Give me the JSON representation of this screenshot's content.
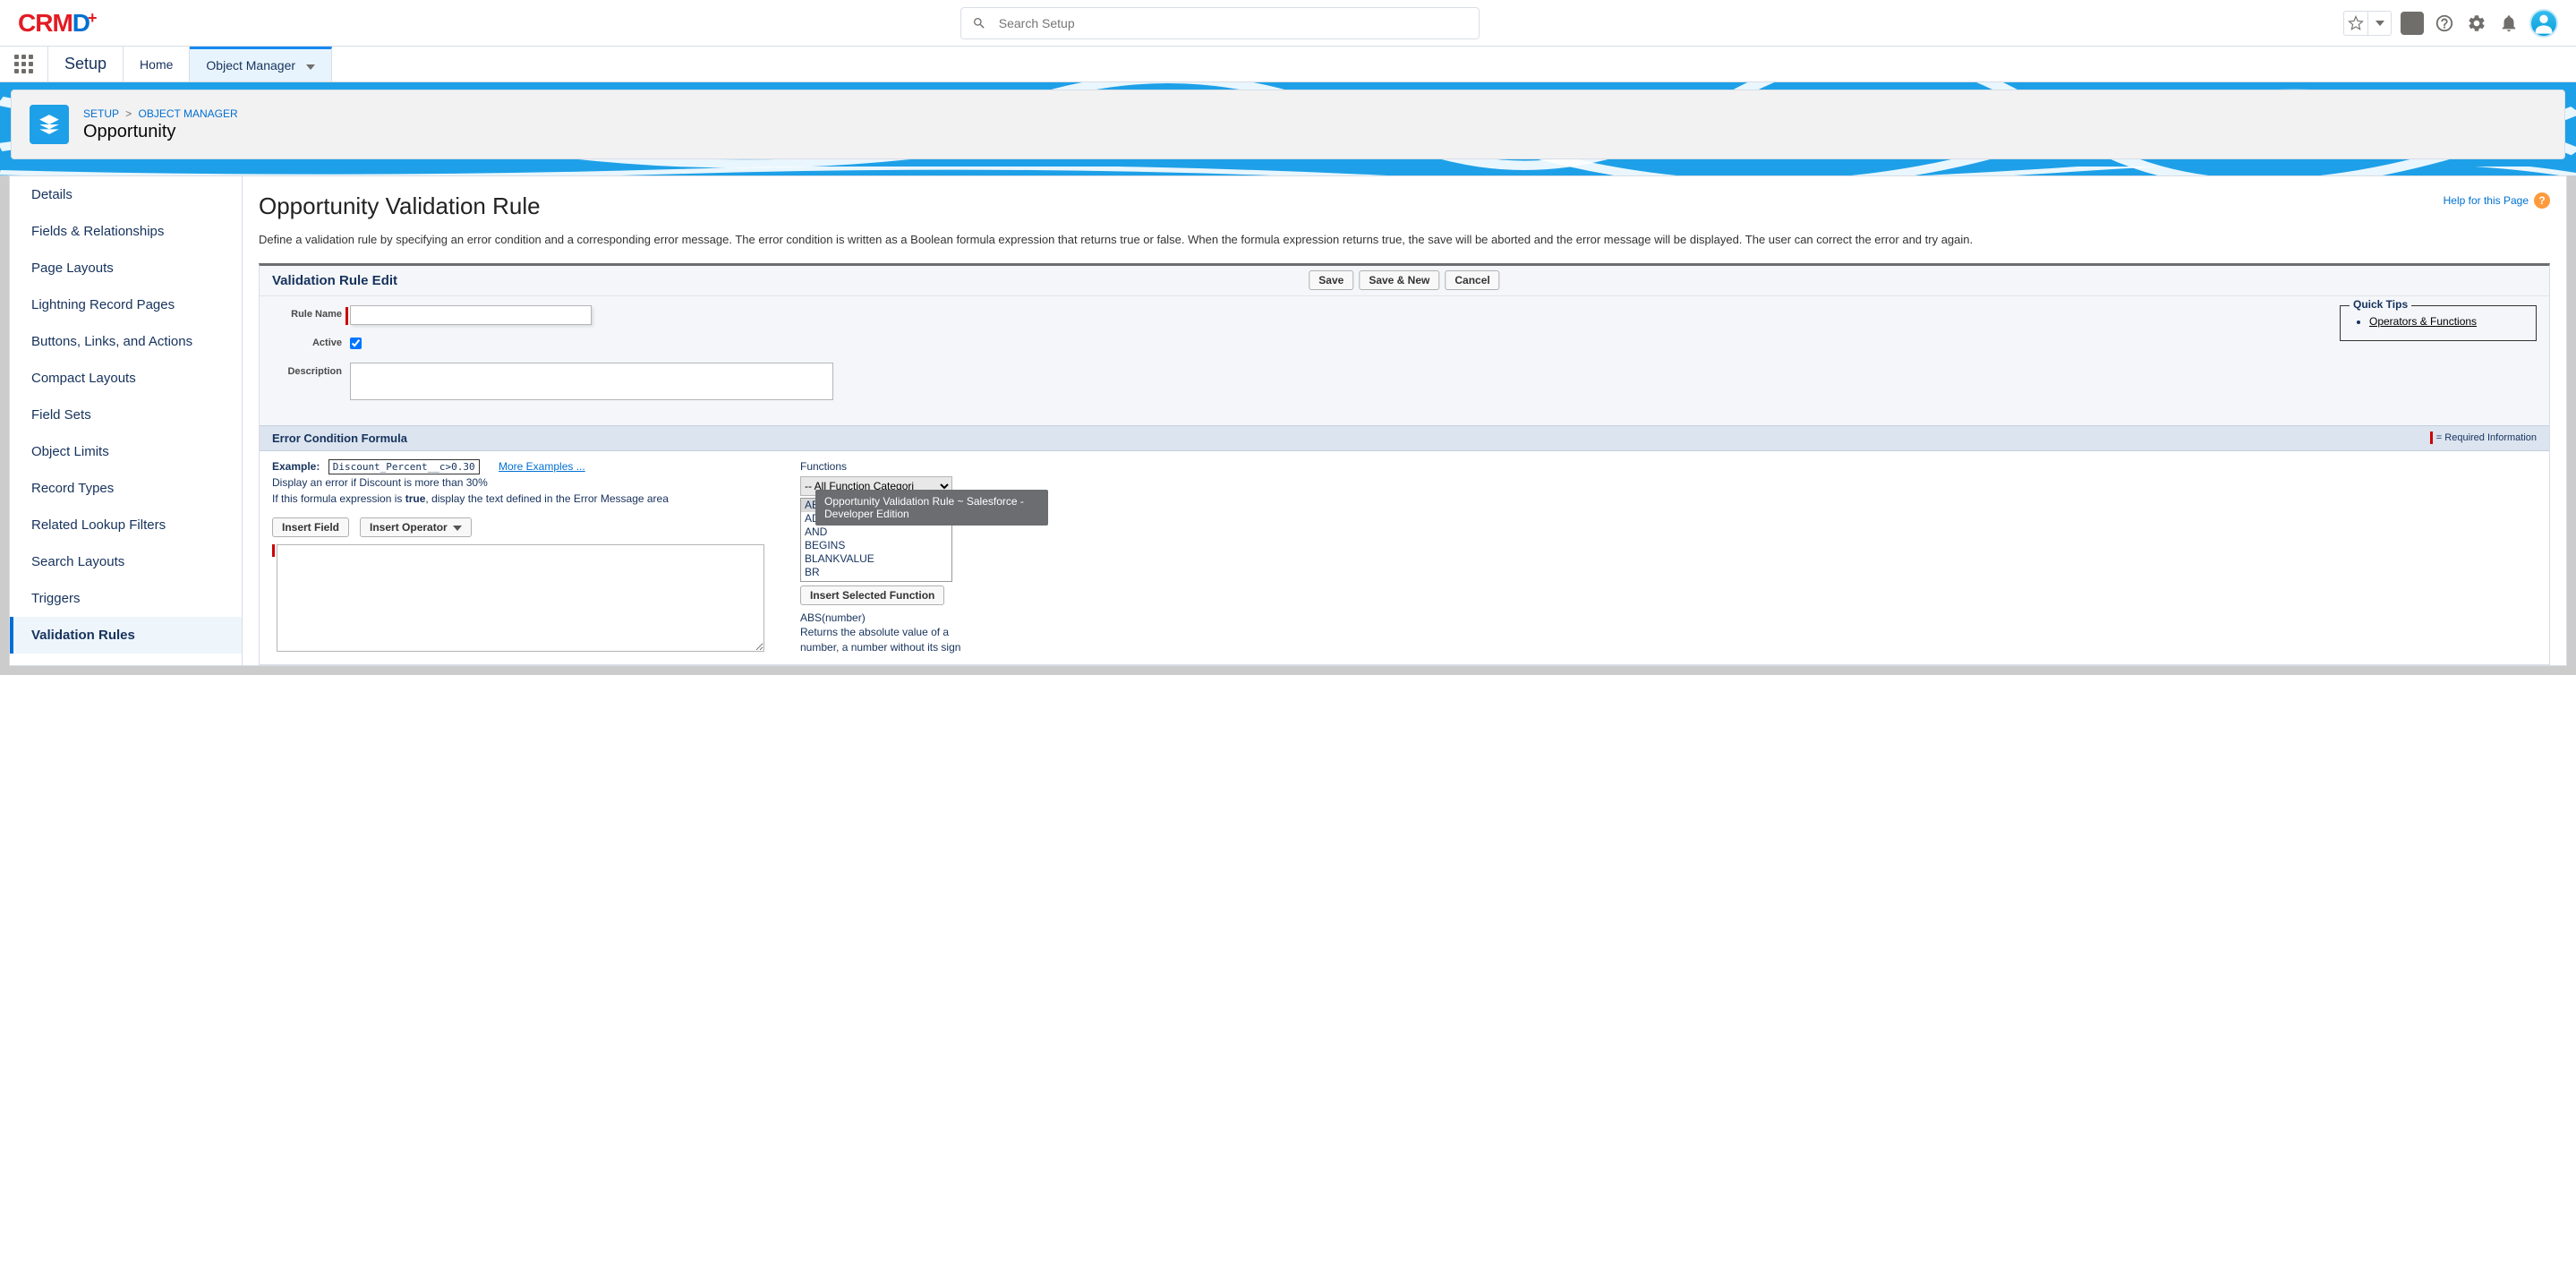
{
  "header": {
    "logo_text": "CRMD+",
    "search_placeholder": "Search Setup"
  },
  "nav": {
    "app_name": "Setup",
    "tabs": [
      "Home",
      "Object Manager"
    ],
    "active_tab": 1
  },
  "breadcrumb": {
    "root": "SETUP",
    "parent": "OBJECT MANAGER",
    "title": "Opportunity"
  },
  "sidebar": {
    "items": [
      "Details",
      "Fields & Relationships",
      "Page Layouts",
      "Lightning Record Pages",
      "Buttons, Links, and Actions",
      "Compact Layouts",
      "Field Sets",
      "Object Limits",
      "Record Types",
      "Related Lookup Filters",
      "Search Layouts",
      "Triggers",
      "Validation Rules"
    ],
    "active": 12
  },
  "main": {
    "page_title": "Opportunity Validation Rule",
    "help_link": "Help for this Page",
    "description": "Define a validation rule by specifying an error condition and a corresponding error message. The error condition is written as a Boolean formula expression that returns true or false. When the formula expression returns true, the save will be aborted and the error message will be displayed. The user can correct the error and try again.",
    "panel_title": "Validation Rule Edit",
    "buttons": {
      "save": "Save",
      "save_new": "Save & New",
      "cancel": "Cancel"
    },
    "fields": {
      "rule_name_label": "Rule Name",
      "active_label": "Active",
      "description_label": "Description"
    },
    "quick_tips": {
      "title": "Quick Tips",
      "link": "Operators & Functions"
    },
    "section_title": "Error Condition Formula",
    "required_info": "= Required Information",
    "example": {
      "label": "Example:",
      "code": "Discount_Percent__c>0.30",
      "more": "More Examples ...",
      "hint1": "Display an error if Discount is more than 30%",
      "hint2_prefix": "If this formula expression is ",
      "hint2_bold": "true",
      "hint2_suffix": ", display the text defined in the Error Message area"
    },
    "insert_field": "Insert Field",
    "insert_operator": "Insert Operator",
    "functions": {
      "label": "Functions",
      "category": "-- All Function Categori",
      "list": [
        "ABS",
        "ADDMONTHS",
        "AND",
        "BEGINS",
        "BLANKVALUE",
        "BR"
      ],
      "selected": "ABS",
      "insert_btn": "Insert Selected Function",
      "desc_sig": "ABS(number)",
      "desc_text": "Returns the absolute value of a number, a number without its sign"
    },
    "tooltip": "Opportunity Validation Rule ~ Salesforce - Developer Edition"
  }
}
